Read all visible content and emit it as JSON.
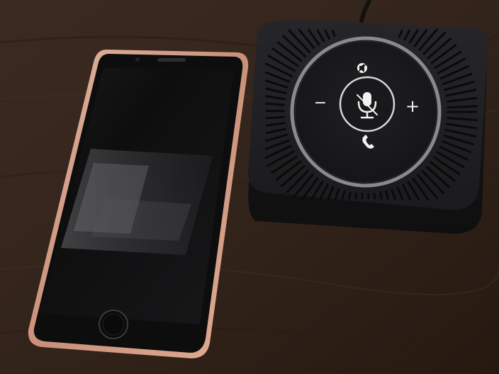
{
  "scene": {
    "subjects": [
      "smartphone",
      "conference-speakerphone"
    ],
    "colors": {
      "desk_wood": "#3a281e",
      "desk_wood_dark": "#22160f",
      "phone_case_rose_gold": "#d8a48c",
      "phone_screen": "#141414",
      "speaker_body": "#1c1c1e",
      "speaker_ring": "#8a8a8e",
      "icon_white": "#f2f2f2"
    }
  },
  "speaker_controls": {
    "minus_symbol": "−",
    "plus_symbol": "+",
    "icons": [
      "speaker-mute-icon",
      "microphone-mute-icon",
      "phone-call-icon",
      "volume-down-icon",
      "volume-up-icon"
    ]
  }
}
